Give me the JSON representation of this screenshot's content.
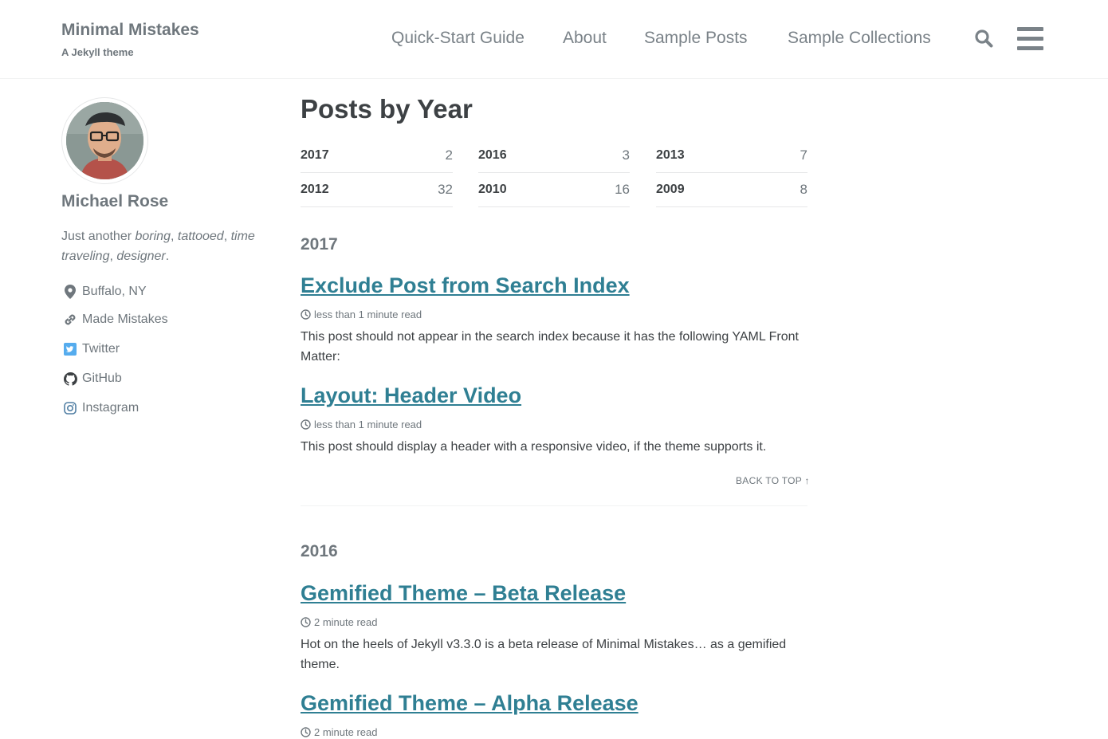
{
  "site": {
    "title": "Minimal Mistakes",
    "subtitle": "A Jekyll theme"
  },
  "nav": {
    "links": [
      "Quick-Start Guide",
      "About",
      "Sample Posts",
      "Sample Collections"
    ],
    "search_icon": "search-icon",
    "menu_icon": "hamburger-menu-icon"
  },
  "author": {
    "name": "Michael Rose",
    "bio_prefix": "Just another ",
    "bio_boring": "boring",
    "bio_tattooed": "tattooed",
    "bio_time": "time traveling",
    "bio_designer": "designer",
    "sep1": ", ",
    "sep2": ", ",
    "sep3": ", ",
    "end": ".",
    "links": [
      {
        "label": "Buffalo, NY",
        "icon": "map-marker-icon"
      },
      {
        "label": "Made Mistakes",
        "icon": "link-icon"
      },
      {
        "label": "Twitter",
        "icon": "twitter-icon",
        "color": "#55acee"
      },
      {
        "label": "GitHub",
        "icon": "github-icon"
      },
      {
        "label": "Instagram",
        "icon": "instagram-icon",
        "color": "#517fa4"
      }
    ]
  },
  "page": {
    "title": "Posts by Year",
    "years": [
      {
        "year": "2017",
        "count": "2"
      },
      {
        "year": "2016",
        "count": "3"
      },
      {
        "year": "2013",
        "count": "7"
      },
      {
        "year": "2012",
        "count": "32"
      },
      {
        "year": "2010",
        "count": "16"
      },
      {
        "year": "2009",
        "count": "8"
      }
    ],
    "sections": [
      {
        "year": "2017",
        "posts": [
          {
            "title": "Exclude Post from Search Index",
            "read": "less than 1 minute read",
            "excerpt": "This post should not appear in the search index because it has the following YAML Front Matter:"
          },
          {
            "title": "Layout: Header Video",
            "read": "less than 1 minute read",
            "excerpt": "This post should display a header with a responsive video, if the theme supports it."
          }
        ],
        "back_to_top": "BACK TO TOP ↑"
      },
      {
        "year": "2016",
        "posts": [
          {
            "title": "Gemified Theme – Beta Release",
            "read": "2 minute read",
            "excerpt": "Hot on the heels of Jekyll v3.3.0 is a beta release of Minimal Mistakes… as a gemified theme."
          },
          {
            "title": "Gemified Theme – Alpha Release",
            "read": "2 minute read"
          }
        ]
      }
    ]
  },
  "colors": {
    "link": "#2f7f93",
    "text": "#3d4144",
    "muted": "#6f777d"
  }
}
